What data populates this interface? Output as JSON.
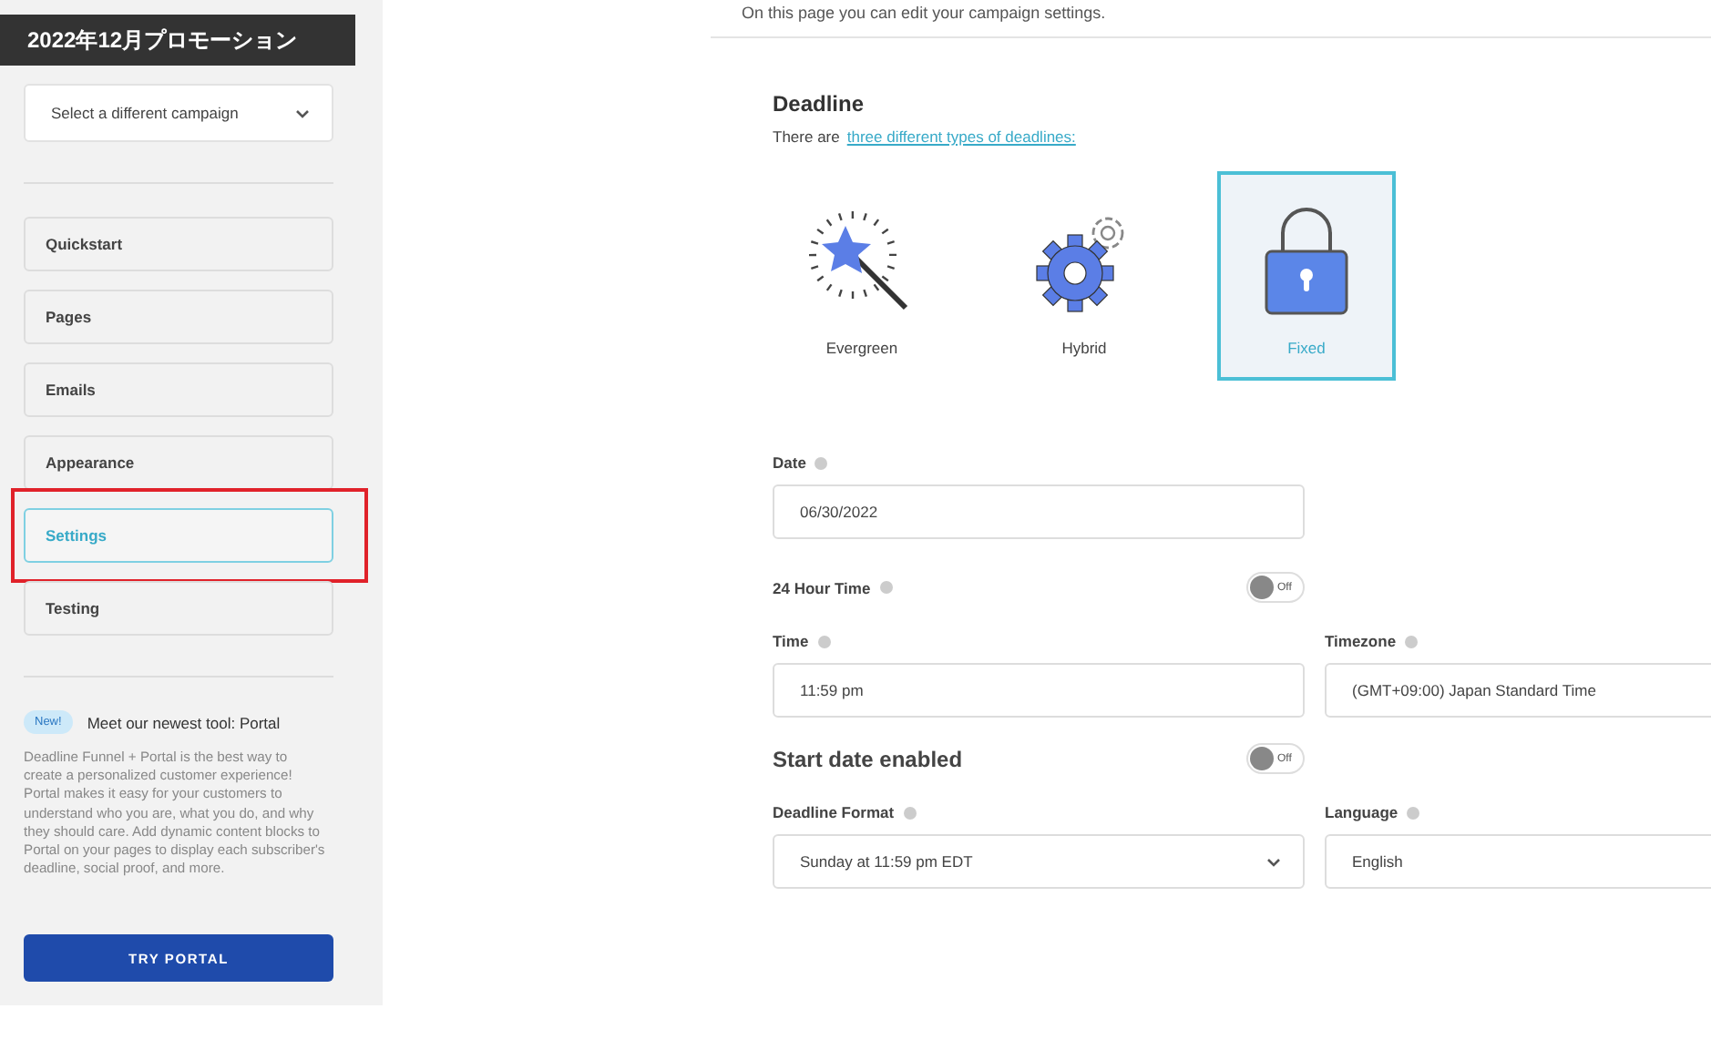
{
  "sidebar": {
    "campaign_title": "2022年12月プロモーション",
    "campaign_select": {
      "value": "Select a different campaign"
    },
    "nav_items": [
      {
        "label": "Quickstart",
        "selected": false,
        "highlighted": false
      },
      {
        "label": "Pages",
        "selected": false,
        "highlighted": false
      },
      {
        "label": "Emails",
        "selected": false,
        "highlighted": false
      },
      {
        "label": "Appearance",
        "selected": false,
        "highlighted": false
      },
      {
        "label": "Settings",
        "selected": true,
        "highlighted": true
      },
      {
        "label": "Testing",
        "selected": false,
        "highlighted": false
      }
    ],
    "promo": {
      "badge": "New!",
      "title": "Meet our newest tool: Portal",
      "body": "Deadline Funnel + Portal is the best way to create a personalized customer experience! Portal makes it easy for your customers to understand who you are, what you do, and why they should care. Add dynamic content blocks to Portal on your pages to display each subscriber's deadline, social proof, and more.",
      "button": "TRY PORTAL"
    }
  },
  "main": {
    "intro": "On this page you can edit your campaign settings.",
    "deadline": {
      "heading": "Deadline",
      "text": "There are",
      "link": "three different types of deadlines:",
      "types": [
        {
          "kind": "wand",
          "label": "Evergreen",
          "selected": false
        },
        {
          "kind": "gear",
          "label": "Hybrid",
          "selected": false
        },
        {
          "kind": "lock",
          "label": "Fixed",
          "selected": true
        }
      ]
    },
    "date": {
      "label": "Date",
      "value": "06/30/2022"
    },
    "hour24": {
      "label": "24 Hour Time",
      "toggle": "Off",
      "on": false
    },
    "time": {
      "label": "Time",
      "value": "11:59 pm"
    },
    "timezone": {
      "label": "Timezone",
      "value": "(GMT+09:00) Japan Standard Time"
    },
    "start_date": {
      "label": "Start date enabled",
      "toggle": "Off",
      "on": false
    },
    "deadline_format": {
      "label": "Deadline Format",
      "value": "Sunday at 11:59 pm EDT"
    },
    "language": {
      "label": "Language",
      "value": "English"
    }
  }
}
